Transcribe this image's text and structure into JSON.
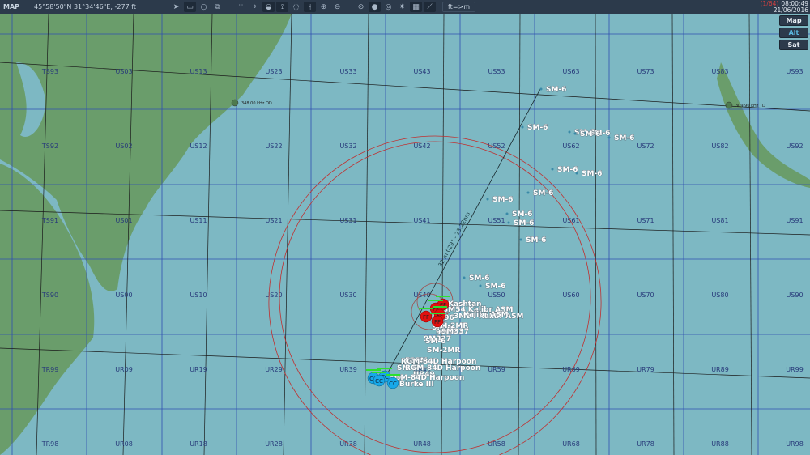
{
  "topbar": {
    "title": "MAP",
    "coords": "45°58'50\"N 31°34'46\"E, -277 ft",
    "unit_toggle": "ft=>m",
    "icons": [
      "send-icon",
      "battery-icon",
      "circle-icon",
      "layers-icon",
      "network-icon",
      "target-icon",
      "wifi-icon",
      "tower-icon",
      "chat-icon",
      "radar-icon",
      "zoom-in-icon",
      "zoom-out-icon",
      "zoom-fit-icon",
      "globe-icon",
      "range-rings-icon",
      "sun-icon",
      "grid-icon",
      "ruler-icon"
    ]
  },
  "clock": {
    "page": "(1/64)",
    "time": "08:00:49",
    "date": "21/06/2016"
  },
  "map_modes": {
    "map": "Map",
    "alt": "Alt",
    "sat": "Sat"
  },
  "grid_labels": [
    [
      "TS93",
      "US03",
      "US13",
      "US23",
      "US33",
      "US43",
      "US53",
      "US63",
      "US73",
      "US83",
      "US93"
    ],
    [
      "TS92",
      "US02",
      "US12",
      "US22",
      "US32",
      "US42",
      "US52",
      "US62",
      "US72",
      "US82",
      "US92"
    ],
    [
      "TS91",
      "US01",
      "US11",
      "US21",
      "US31",
      "US41",
      "US51",
      "US61",
      "US71",
      "US81",
      "US91"
    ],
    [
      "TS90",
      "US00",
      "US10",
      "US20",
      "US30",
      "US40",
      "US50",
      "US60",
      "US70",
      "US80",
      "US90"
    ],
    [
      "TR99",
      "UR09",
      "UR19",
      "UR29",
      "UR39",
      "UR49",
      "UR59",
      "UR69",
      "UR79",
      "UR89",
      "UR99"
    ],
    [
      "TR98",
      "UR08",
      "UR18",
      "UR28",
      "UR38",
      "UR48",
      "UR58",
      "UR68",
      "UR78",
      "UR88",
      "UR98"
    ]
  ],
  "nav_beacons": [
    "348.00 kHz OD",
    "309.90 kHz TD"
  ],
  "range_line_label": "32 m 029° - 23.22nm",
  "missiles": [
    "SM-6",
    "SM-6",
    "SM-6",
    "SM-6",
    "SM-6",
    "SM-6",
    "SM-6",
    "SM-6",
    "SM-6",
    "SM-6",
    "SM-6",
    "SM-6",
    "SM-6",
    "SM-6",
    "SM-6"
  ],
  "hostile_labels": [
    "Kashtan",
    "3M54 Kalibr ASM",
    "3M54 Kalibr ASM",
    "9M96",
    "Kalibr ASM",
    "9M337",
    "9M337",
    "SM-6",
    "SM-2MR",
    "SM-6",
    "SM-2MR",
    "9M337"
  ],
  "friendly_labels": [
    "ESSM",
    "RGM-84D Harpoon",
    "SM-6",
    "RGM-84D Harpoon",
    "UR49",
    "ESSM",
    "RGM-84D Harpoon",
    "Burke III"
  ],
  "unit_marks": {
    "hostile": "FF",
    "friendly": "CC"
  },
  "colors": {
    "water": "#7db8c3",
    "land": "#6a9d6b",
    "hostile": "#e01010",
    "friendly": "#18a8e8"
  }
}
